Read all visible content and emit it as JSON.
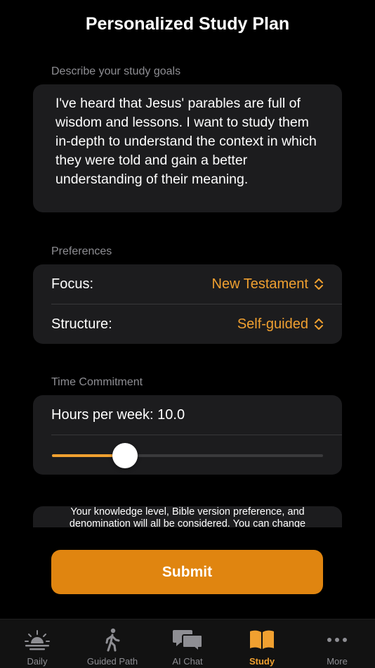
{
  "header": {
    "title": "Personalized Study Plan"
  },
  "goals": {
    "label": "Describe your study goals",
    "text": "I've heard that Jesus' parables are full of wisdom and lessons. I want to study them in-depth to understand the context in which they were told and gain a better understanding of their meaning."
  },
  "preferences": {
    "label": "Preferences",
    "focus": {
      "label": "Focus:",
      "value": "New Testament"
    },
    "structure": {
      "label": "Structure:",
      "value": "Self-guided"
    }
  },
  "time": {
    "label": "Time Commitment",
    "hours_label": "Hours per week: 10.0",
    "slider_fraction": 0.27
  },
  "note": {
    "text": "Your knowledge level, Bible version preference, and denomination will all be considered. You can change"
  },
  "submit": {
    "label": "Submit"
  },
  "tabs": [
    {
      "label": "Daily",
      "icon": "sunrise-icon"
    },
    {
      "label": "Guided Path",
      "icon": "walking-figure-icon"
    },
    {
      "label": "AI Chat",
      "icon": "chat-bubbles-icon"
    },
    {
      "label": "Study",
      "icon": "open-book-icon",
      "active": true
    },
    {
      "label": "More",
      "icon": "ellipsis-icon"
    }
  ],
  "colors": {
    "accent": "#f0a030",
    "submit_bg": "#e08510",
    "card_bg": "#1c1c1e",
    "inactive_tab": "#8e8e93"
  }
}
